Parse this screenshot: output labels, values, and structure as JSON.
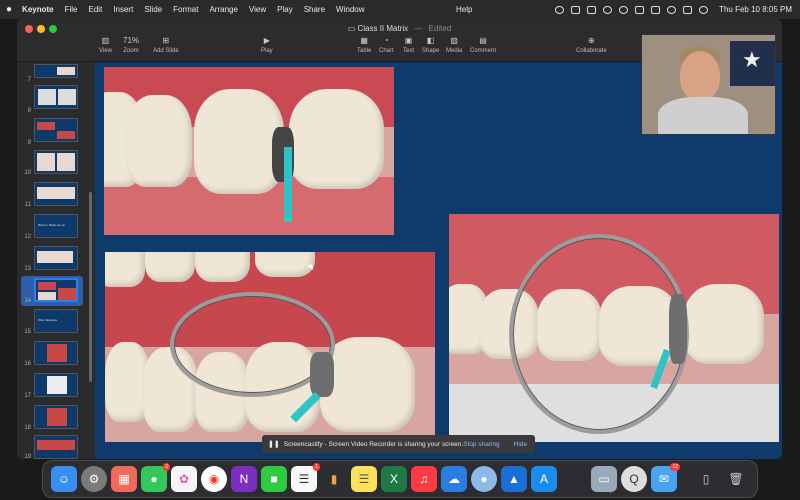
{
  "menubar": {
    "apple": "",
    "items": [
      "Keynote",
      "File",
      "Edit",
      "Insert",
      "Slide",
      "Format",
      "Arrange",
      "View",
      "Play",
      "Share",
      "Window"
    ],
    "help": "Help",
    "clock": "Thu Feb 10  8:05 PM"
  },
  "window": {
    "title": "Class II Matrix",
    "title_sep": "—",
    "status": "Edited",
    "zoom_value": "71%",
    "toolbar": {
      "view": "View",
      "zoom": "Zoom",
      "add_slide": "Add Slide",
      "play": "Play",
      "table": "Table",
      "chart": "Chart",
      "text": "Text",
      "shape": "Shape",
      "media": "Media",
      "comment": "Comment",
      "collaborate": "Collaborate"
    }
  },
  "sidebar": {
    "slides": [
      "7",
      "8",
      "9",
      "10",
      "11",
      "12",
      "13",
      "14",
      "15",
      "16",
      "17",
      "18",
      "19"
    ],
    "selected": "14",
    "slide12_text": "Back to Basic set up",
    "slide15_text": "Wire Metaleve"
  },
  "screencast": {
    "message": "Screencastify - Screen Video Recorder is sharing your screen.",
    "stop": "Stop sharing",
    "hide": "Hide"
  },
  "dock": {
    "messages_badge": "2",
    "reminders_badge": "1",
    "mail_badge": "12"
  },
  "colors": {
    "canvas_bg": "#0e3b6b",
    "selection": "#2e7cf6",
    "wedge": "#2ec4c7"
  }
}
